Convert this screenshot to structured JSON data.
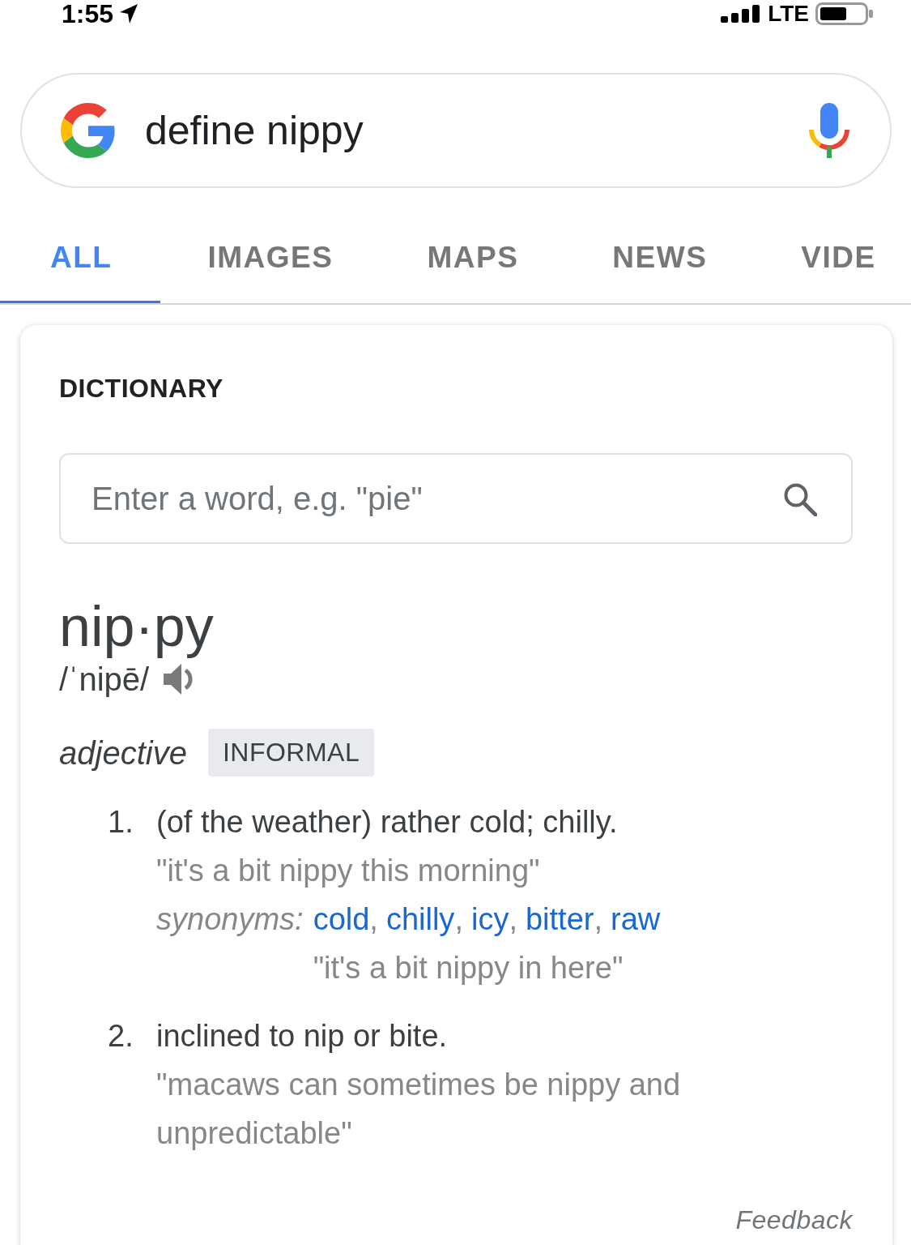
{
  "status_bar": {
    "time": "1:55",
    "network": "LTE"
  },
  "search": {
    "query": "define nippy"
  },
  "tabs": [
    {
      "label": "ALL",
      "selected": true
    },
    {
      "label": "IMAGES",
      "selected": false
    },
    {
      "label": "MAPS",
      "selected": false
    },
    {
      "label": "NEWS",
      "selected": false
    },
    {
      "label": "VIDE",
      "selected": false
    }
  ],
  "dictionary": {
    "heading": "DICTIONARY",
    "search_placeholder": "Enter a word, e.g. \"pie\"",
    "headword": "nip·py",
    "pronunciation": "/ˈnipē/",
    "part_of_speech": "adjective",
    "register_label": "INFORMAL",
    "senses": [
      {
        "number": "1.",
        "definition": "(of the weather) rather cold; chilly.",
        "example": "\"it's a bit nippy this morning\"",
        "synonyms": {
          "label": "synonyms:",
          "separator": ",",
          "words": [
            "cold",
            "chilly",
            "icy",
            "bitter",
            "raw"
          ],
          "example": "\"it's a bit nippy in here\""
        }
      },
      {
        "number": "2.",
        "definition": "inclined to nip or bite.",
        "example": "\"macaws can sometimes be nippy and unpredictable\""
      }
    ],
    "feedback": "Feedback"
  }
}
